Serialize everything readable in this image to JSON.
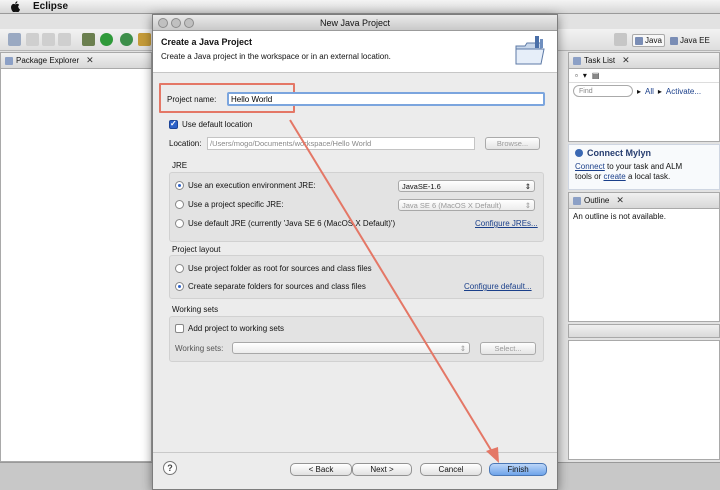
{
  "menubar": {
    "app_name": "Eclipse"
  },
  "perspectives": {
    "java": "Java",
    "javaee": "Java EE"
  },
  "package_explorer": {
    "title": "Package Explorer"
  },
  "task_list": {
    "title": "Task List",
    "find_placeholder": "Find",
    "all_label": "All",
    "activate_label": "Activate..."
  },
  "mylyn": {
    "title": "Connect Mylyn",
    "connect_link": "Connect",
    "text_1": "to your task and ALM",
    "text_2": "tools or",
    "create_link": "create",
    "text_3": "a local task."
  },
  "outline": {
    "title": "Outline",
    "message": "An outline is not available."
  },
  "dialog": {
    "window_title": "New Java Project",
    "heading": "Create a Java Project",
    "description": "Create a Java project in the workspace or in an external location.",
    "project_name_label": "Project name:",
    "project_name_value": "Hello World",
    "use_default_location_label": "Use default location",
    "location_label": "Location:",
    "location_value": "/Users/mogo/Documents/workspace/Hello World",
    "browse_label": "Browse...",
    "jre_section_label": "JRE",
    "jre_options": {
      "execution_env": "Use an execution environment JRE:",
      "project_specific": "Use a project specific JRE:",
      "default_jre": "Use default JRE (currently 'Java SE 6 (MacOS X Default)')"
    },
    "execution_env_value": "JavaSE-1.6",
    "project_specific_value": "Java SE 6 (MacOS X Default)",
    "configure_jres_link": "Configure JREs...",
    "project_layout_label": "Project layout",
    "layout_options": {
      "root_folder": "Use project folder as root for sources and class files",
      "separate_folders": "Create separate folders for sources and class files"
    },
    "configure_default_link": "Configure default...",
    "working_sets_label": "Working sets",
    "add_to_working_sets_label": "Add project to working sets",
    "working_sets_field_label": "Working sets:",
    "select_label": "Select...",
    "buttons": {
      "back": "< Back",
      "next": "Next >",
      "cancel": "Cancel",
      "finish": "Finish"
    },
    "help_icon_glyph": "?"
  },
  "colors": {
    "callout": "#e47766",
    "link": "#1a3f8a",
    "default_button": "#6ea4ea"
  }
}
